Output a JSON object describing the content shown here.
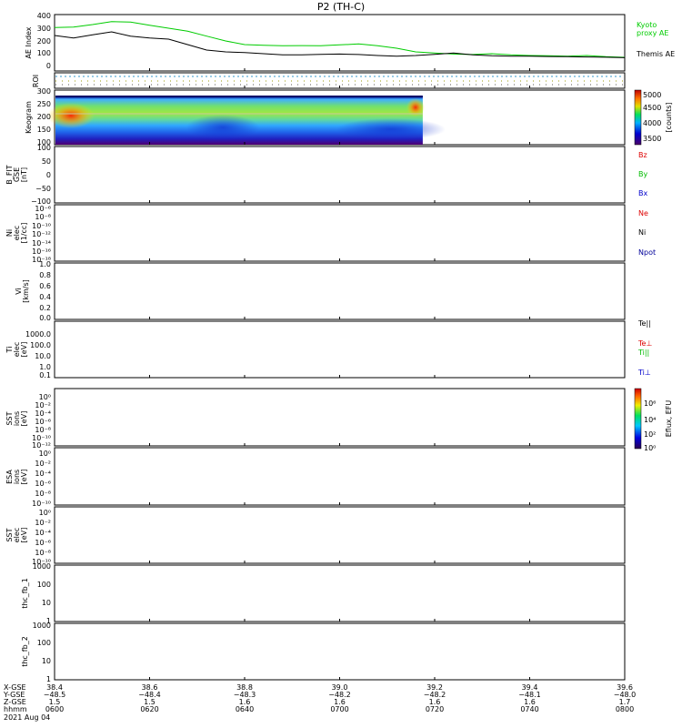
{
  "title": "P2 (TH-C)",
  "date": "2021 Aug 04",
  "colors": {
    "ae_kyoto": "#00cc00",
    "ae_themis": "#000000",
    "bz": "#dd0000",
    "by": "#00bb00",
    "bx": "#0000cc",
    "ne": "#dd0000",
    "ni": "#000000",
    "npot": "#000099",
    "te_par": "#000000",
    "te_perp": "#dd0000",
    "ti_par": "#00bb00",
    "ti_perp": "#0000cc"
  },
  "panels": {
    "ae": {
      "ylabel": "AE Index",
      "ticks": [
        "400",
        "300",
        "200",
        "100",
        "0"
      ],
      "legend_kyoto": [
        "Kyoto",
        "proxy AE"
      ],
      "legend_themis": "Themis AE"
    },
    "roi": {
      "ylabel": "ROI"
    },
    "keogram": {
      "ylabel": "Keogram",
      "ticks": [
        "300",
        "250",
        "200",
        "150",
        "100"
      ],
      "cbar_ticks": [
        "5000",
        "4500",
        "4000",
        "3500"
      ],
      "cbar_label": "[counts]"
    },
    "bfit": {
      "ylabel": [
        "B_FIT",
        "GSE",
        "[nT]"
      ],
      "ticks": [
        "100",
        "50",
        "0",
        "−50",
        "−100"
      ],
      "legend": [
        "Bz",
        "By",
        "Bx"
      ]
    },
    "ni": {
      "ylabel": [
        "Ni",
        "elec",
        "[1/cc]"
      ],
      "ticks": [
        "10⁻⁶",
        "10⁻⁸",
        "10⁻¹⁰",
        "10⁻¹²",
        "10⁻¹⁴",
        "10⁻¹⁶",
        "10⁻¹⁸"
      ],
      "legend": [
        "Ne",
        "Ni",
        "Npot"
      ]
    },
    "vi": {
      "ylabel": [
        "Vi",
        "[km/s]"
      ],
      "ticks": [
        "1.0",
        "0.8",
        "0.6",
        "0.4",
        "0.2",
        "0.0"
      ]
    },
    "ti": {
      "ylabel": [
        "Ti",
        "elec",
        "[eV]"
      ],
      "ticks": [
        "1000.0",
        "100.0",
        "10.0",
        "1.0",
        "0.1"
      ],
      "legend": [
        "Te||",
        "Te⊥",
        "Ti||",
        "Ti⊥"
      ]
    },
    "sst_i": {
      "ylabel": [
        "SST",
        "ions",
        "[eV]"
      ],
      "ticks": [
        "10⁰",
        "10⁻²",
        "10⁻⁴",
        "10⁻⁶",
        "10⁻⁸",
        "10⁻¹⁰",
        "10⁻¹²"
      ],
      "cbar_ticks": [
        "10⁶",
        "10⁴",
        "10²",
        "10⁰"
      ],
      "cbar_label": "Eflux, EFU"
    },
    "esa": {
      "ylabel": [
        "ESA",
        "ions",
        "[eV]"
      ],
      "ticks": [
        "10⁰",
        "10⁻²",
        "10⁻⁴",
        "10⁻⁶",
        "10⁻⁸",
        "10⁻¹⁰"
      ]
    },
    "sst_e": {
      "ylabel": [
        "SST",
        "elec",
        "[eV]"
      ],
      "ticks": [
        "10⁰",
        "10⁻²",
        "10⁻⁴",
        "10⁻⁶",
        "10⁻⁸",
        "10⁻¹⁰"
      ]
    },
    "fb1": {
      "ylabel": "thc_fb_1",
      "ticks": [
        "1000",
        "100",
        "10",
        "1"
      ]
    },
    "fb2": {
      "ylabel": "thc_fb_2",
      "ticks": [
        "1000",
        "100",
        "10",
        "1"
      ]
    }
  },
  "xaxis": {
    "row_labels": [
      "X-GSE",
      "Y-GSE",
      "Z-GSE",
      "hhmm"
    ],
    "columns": [
      {
        "x": "38.4",
        "y": "−48.5",
        "z": "1.5",
        "t": "0600"
      },
      {
        "x": "38.6",
        "y": "−48.4",
        "z": "1.5",
        "t": "0620"
      },
      {
        "x": "38.8",
        "y": "−48.3",
        "z": "1.6",
        "t": "0640"
      },
      {
        "x": "39.0",
        "y": "−48.2",
        "z": "1.6",
        "t": "0700"
      },
      {
        "x": "39.2",
        "y": "−48.2",
        "z": "1.6",
        "t": "0720"
      },
      {
        "x": "39.4",
        "y": "−48.1",
        "z": "1.6",
        "t": "0740"
      },
      {
        "x": "39.6",
        "y": "−48.0",
        "z": "1.7",
        "t": "0800"
      }
    ]
  },
  "chart_data": [
    {
      "type": "line",
      "ylabel": "AE Index",
      "ylim": [
        -30,
        420
      ],
      "x_unit": "minutes since 0600",
      "series": [
        {
          "name": "Kyoto proxy AE",
          "x": [
            0,
            8,
            16,
            24,
            32,
            40,
            48,
            56,
            64,
            72,
            80,
            88,
            96,
            104,
            112,
            120,
            128,
            136,
            144,
            152,
            160,
            168,
            176,
            184,
            192,
            200,
            208,
            216,
            224,
            232,
            240
          ],
          "values": [
            320,
            325,
            345,
            370,
            365,
            340,
            315,
            290,
            250,
            210,
            180,
            175,
            170,
            172,
            170,
            178,
            185,
            170,
            150,
            120,
            110,
            102,
            98,
            105,
            95,
            90,
            88,
            85,
            90,
            80,
            75
          ]
        },
        {
          "name": "Themis AE",
          "x": [
            0,
            8,
            16,
            24,
            32,
            40,
            48,
            56,
            64,
            72,
            80,
            88,
            96,
            104,
            112,
            120,
            128,
            136,
            144,
            152,
            160,
            168,
            176,
            184,
            192,
            200,
            208,
            216,
            224,
            232,
            240
          ],
          "values": [
            255,
            235,
            260,
            285,
            250,
            235,
            225,
            180,
            135,
            120,
            115,
            105,
            95,
            95,
            100,
            102,
            98,
            90,
            85,
            90,
            100,
            110,
            95,
            88,
            85,
            85,
            82,
            80,
            78,
            76,
            72
          ]
        }
      ]
    },
    {
      "type": "heatmap",
      "ylabel": "Keogram",
      "ylim": [
        100,
        300
      ],
      "zlim": [
        3300,
        5100
      ],
      "x_range_minutes": [
        0,
        155
      ]
    }
  ]
}
